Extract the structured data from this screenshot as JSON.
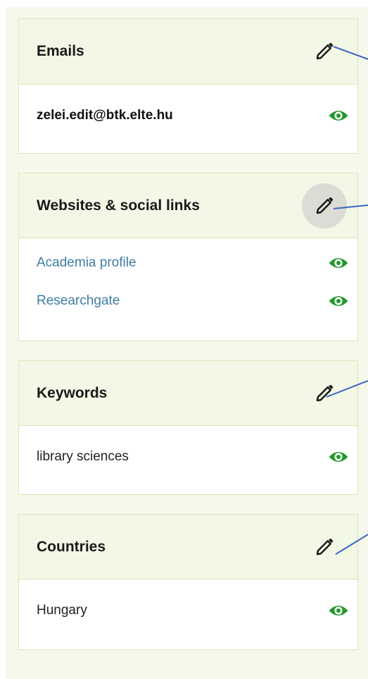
{
  "colors": {
    "panel_background": "#f6f8ec",
    "card_header": "#f3f7e6",
    "card_border": "#dbe6b8",
    "visibility_icon": "#1f9a2c",
    "link_text": "#3f7da3",
    "callout_line": "#3a66c4",
    "edit_button_hover": "#dcdcd6"
  },
  "sections": {
    "emails": {
      "title": "Emails",
      "edit_icon": "pencil-icon",
      "items": [
        {
          "text": "zelei.edit@btk.elte.hu",
          "visibility_icon": "eye-icon"
        }
      ]
    },
    "websites": {
      "title": "Websites & social links",
      "edit_icon": "pencil-icon",
      "items": [
        {
          "text": "Academia profile",
          "visibility_icon": "eye-icon"
        },
        {
          "text": "Researchgate",
          "visibility_icon": "eye-icon"
        }
      ]
    },
    "keywords": {
      "title": "Keywords",
      "edit_icon": "pencil-icon",
      "items": [
        {
          "text": "library sciences",
          "visibility_icon": "eye-icon"
        }
      ]
    },
    "countries": {
      "title": "Countries",
      "edit_icon": "pencil-icon",
      "items": [
        {
          "text": "Hungary",
          "visibility_icon": "eye-icon"
        }
      ]
    }
  }
}
